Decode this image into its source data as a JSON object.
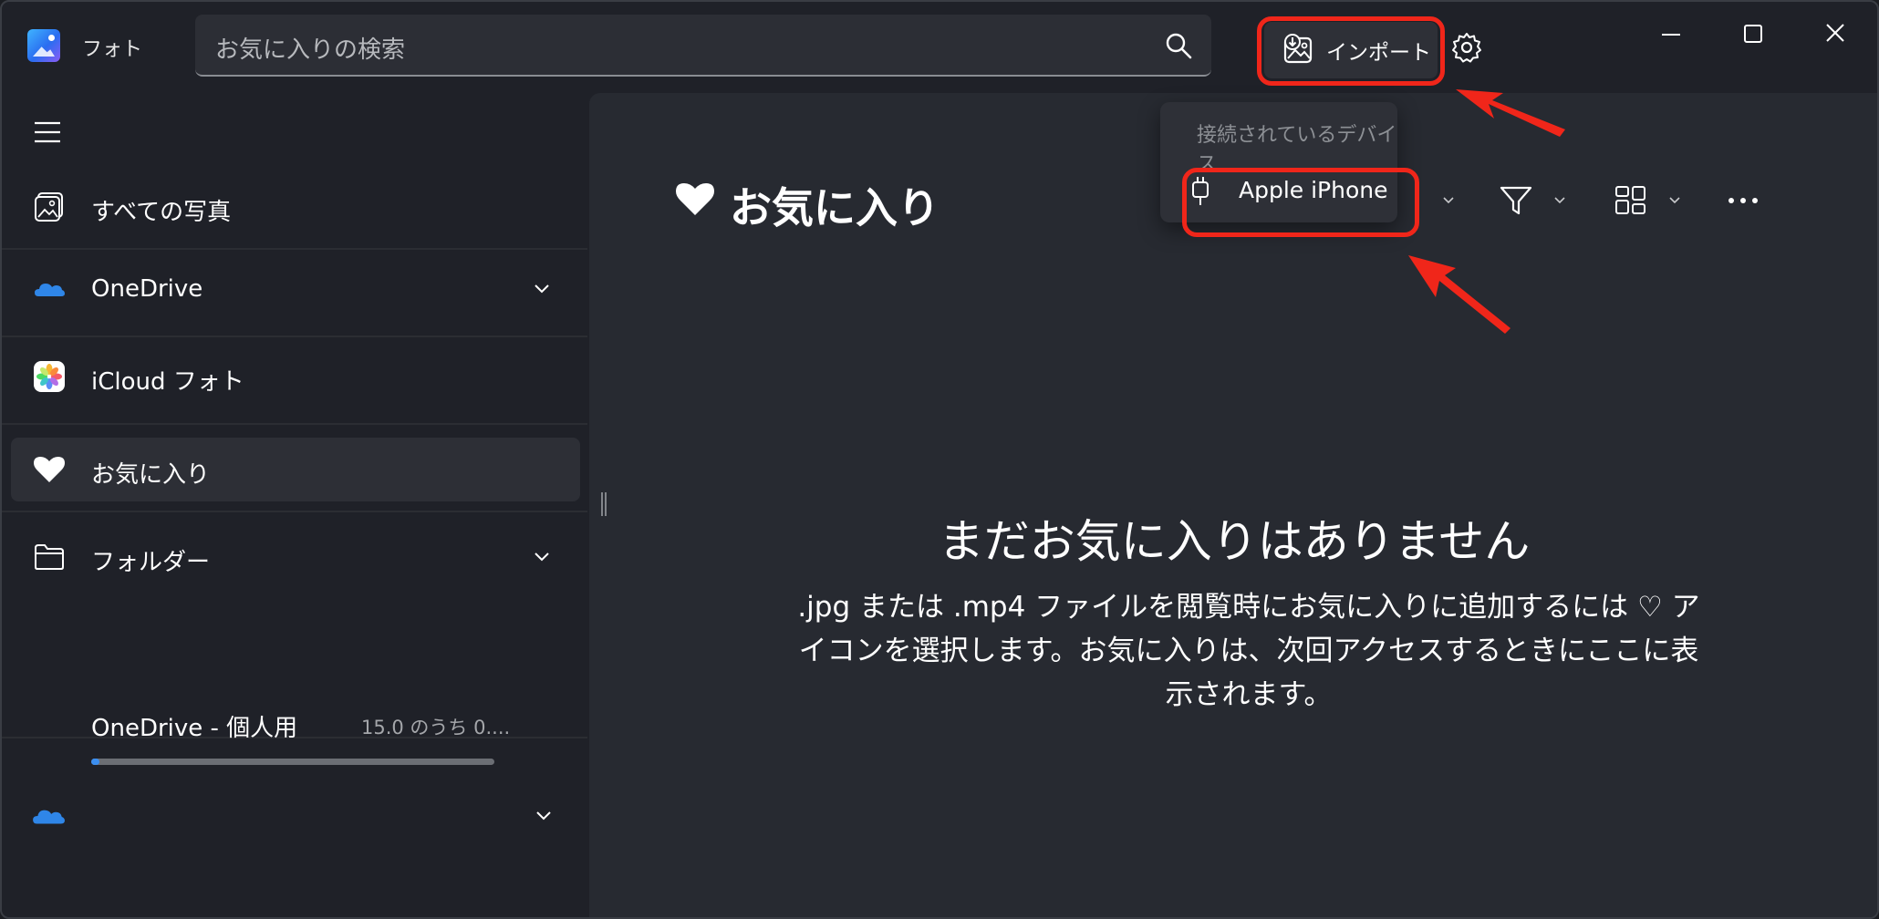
{
  "app": {
    "title": "フォト"
  },
  "search": {
    "placeholder": "お気に入りの検索"
  },
  "toolbar": {
    "import_label": "インポート"
  },
  "sidebar": {
    "items": [
      {
        "label": "すべての写真"
      },
      {
        "label": "OneDrive"
      },
      {
        "label": "iCloud フォト"
      },
      {
        "label": "お気に入り"
      },
      {
        "label": "フォルダー"
      }
    ],
    "onedrive_account": {
      "label": "OneDrive - 個人用",
      "quota_text": "15.0 のうち 0....",
      "usage_fraction": 0.02
    }
  },
  "main": {
    "title": "お気に入り",
    "empty_title": "まだお気に入りはありません",
    "empty_description": ".jpg または .mp4 ファイルを閲覧時にお気に入りに追加するには ♡ アイコンを選択します。お気に入りは、次回アクセスするときにここに表示されます。"
  },
  "import_menu": {
    "header": "接続されているデバイス",
    "devices": [
      {
        "label": "Apple iPhone"
      }
    ]
  },
  "colors": {
    "accent": "#3b8ef0",
    "annotation": "#f0261a",
    "panel": "#272a31",
    "sidebar": "#1f2128"
  },
  "icons": [
    "app-logo-icon",
    "search-icon",
    "import-icon",
    "gear-icon",
    "minimize-icon",
    "maximize-icon",
    "close-icon",
    "hamburger-icon",
    "photos-icon",
    "onedrive-icon",
    "icloud-photos-icon",
    "heart-icon",
    "folder-icon",
    "chevron-down-icon",
    "filter-icon",
    "layout-icon",
    "more-icon",
    "usb-cable-icon"
  ]
}
